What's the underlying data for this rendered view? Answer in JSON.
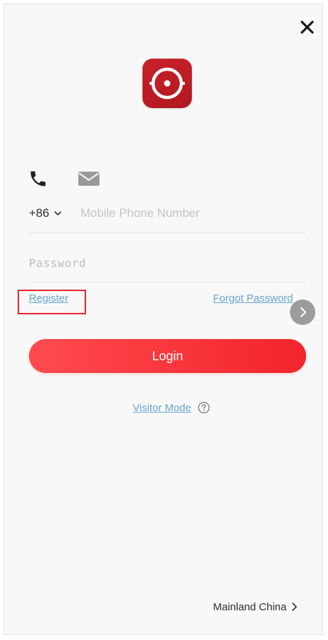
{
  "login": {
    "country_code": "+86",
    "phone_placeholder": "Mobile Phone Number",
    "password_placeholder": "Password",
    "register_label": "Register",
    "forgot_label": "Forgot Password",
    "login_label": "Login",
    "visitor_label": "Visitor Mode",
    "region_label": "Mainland China"
  },
  "icons": {
    "close": "close-icon",
    "logo": "app-logo-icon",
    "phone": "phone-icon",
    "email": "email-icon",
    "country_dropdown": "chevron-down-icon",
    "help": "help-icon",
    "floating": "chevron-right-icon",
    "region": "chevron-right-icon"
  },
  "colors": {
    "accent": "#f2242b",
    "link": "#6aa3cf",
    "logo_bg": "#c8222c",
    "highlight": "#e8262a"
  }
}
